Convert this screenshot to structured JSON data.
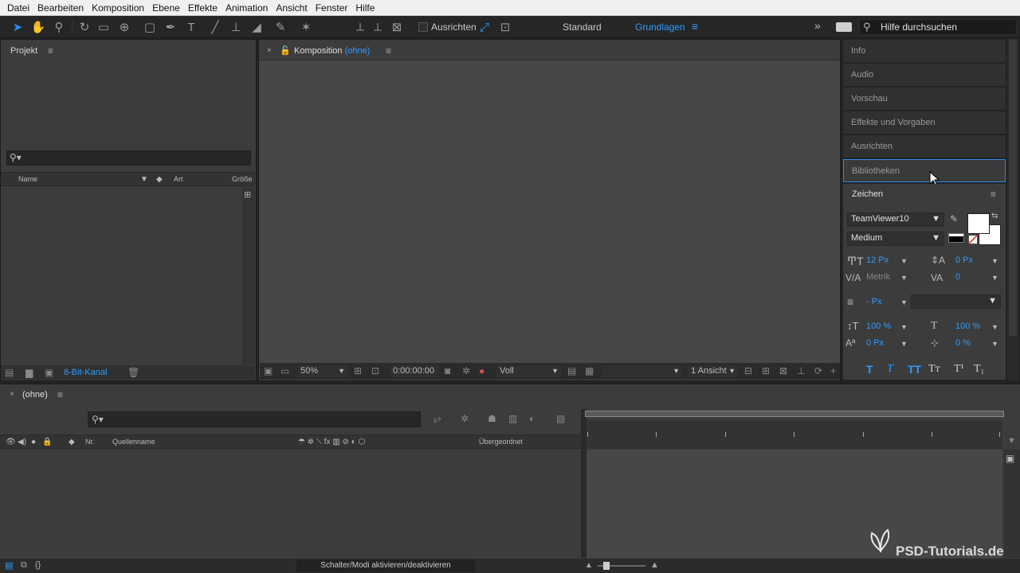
{
  "menu": [
    "Datei",
    "Bearbeiten",
    "Komposition",
    "Ebene",
    "Effekte",
    "Animation",
    "Ansicht",
    "Fenster",
    "Hilfe"
  ],
  "toolbar": {
    "ausrichten_label": "Ausrichten",
    "workspace_standard": "Standard",
    "workspace_grundlagen": "Grundlagen",
    "help_placeholder": "Hilfe durchsuchen"
  },
  "project": {
    "title": "Projekt",
    "columns": [
      "Name",
      "Art",
      "Größe"
    ],
    "bit_depth": "8-Bit-Kanal"
  },
  "composition": {
    "title": "Komposition",
    "name": "(ohne)",
    "zoom": "50%",
    "timecode": "0:00:00:00",
    "resolution": "Voll",
    "views": "1 Ansicht"
  },
  "right_panels": {
    "tabs": [
      "Info",
      "Audio",
      "Vorschau",
      "Effekte und Vorgaben",
      "Ausrichten",
      "Bibliotheken"
    ],
    "active_tab": "Bibliotheken"
  },
  "zeichen": {
    "title": "Zeichen",
    "font": "TeamViewer10",
    "style": "Medium",
    "size": "12 Px",
    "leading": "0 Px",
    "kerning": "Metrik",
    "tracking": "0",
    "stroke": "- Px",
    "vscale": "100 %",
    "hscale": "100 %",
    "baseline": "0 Px",
    "tsume": "0 %",
    "colors": {
      "fill": "#ffffff",
      "stroke": "#ffffff",
      "accent": "#2d9cff"
    }
  },
  "timeline": {
    "title": "(ohne)",
    "columns": [
      "Nr.",
      "Quellenname",
      "Übergeordnet"
    ],
    "toggle_label": "Schalter/Modi aktivieren/deaktivieren"
  },
  "watermark": "PSD-Tutorials.de"
}
